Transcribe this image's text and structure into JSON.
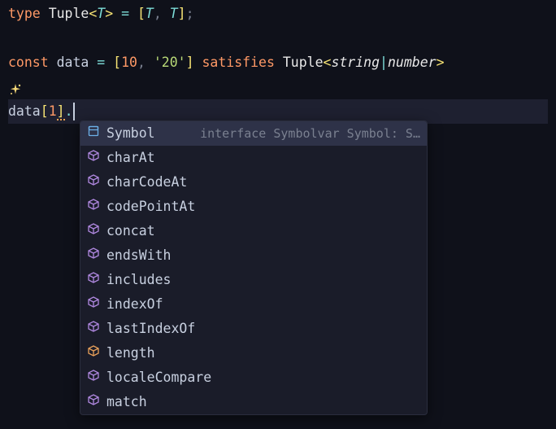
{
  "code": {
    "line1": {
      "kw_type": "type",
      "name": "Tuple",
      "generic_open": "<",
      "generic_var": "T",
      "generic_close": ">",
      "eq": " = ",
      "bracket_open": "[",
      "t1": "T",
      "comma": ", ",
      "t2": "T",
      "bracket_close": "]",
      "semi": ";"
    },
    "line3": {
      "kw_const": "const",
      "name": "data",
      "eq": " = ",
      "bracket_open": "[",
      "num": "10",
      "comma": ", ",
      "str": "'20'",
      "bracket_close": "]",
      "kw_satisfies": "satisfies",
      "type_name": "Tuple",
      "generic_open": "<",
      "type_string": "string",
      "pipe": "|",
      "type_number": "number",
      "generic_close": ">"
    },
    "line5": {
      "data_ref": "data",
      "bracket_open": "[",
      "idx": "1",
      "bracket_close": "]",
      "dot": "."
    }
  },
  "autocomplete": {
    "detail": "interface Symbolvar Symbol: S…",
    "items": [
      {
        "icon": "interface",
        "label": "Symbol"
      },
      {
        "icon": "method",
        "label": "charAt"
      },
      {
        "icon": "method",
        "label": "charCodeAt"
      },
      {
        "icon": "method",
        "label": "codePointAt"
      },
      {
        "icon": "method",
        "label": "concat"
      },
      {
        "icon": "method",
        "label": "endsWith"
      },
      {
        "icon": "method",
        "label": "includes"
      },
      {
        "icon": "method",
        "label": "indexOf"
      },
      {
        "icon": "method",
        "label": "lastIndexOf"
      },
      {
        "icon": "field",
        "label": "length"
      },
      {
        "icon": "method",
        "label": "localeCompare"
      },
      {
        "icon": "method",
        "label": "match"
      }
    ],
    "selected_index": 0
  }
}
